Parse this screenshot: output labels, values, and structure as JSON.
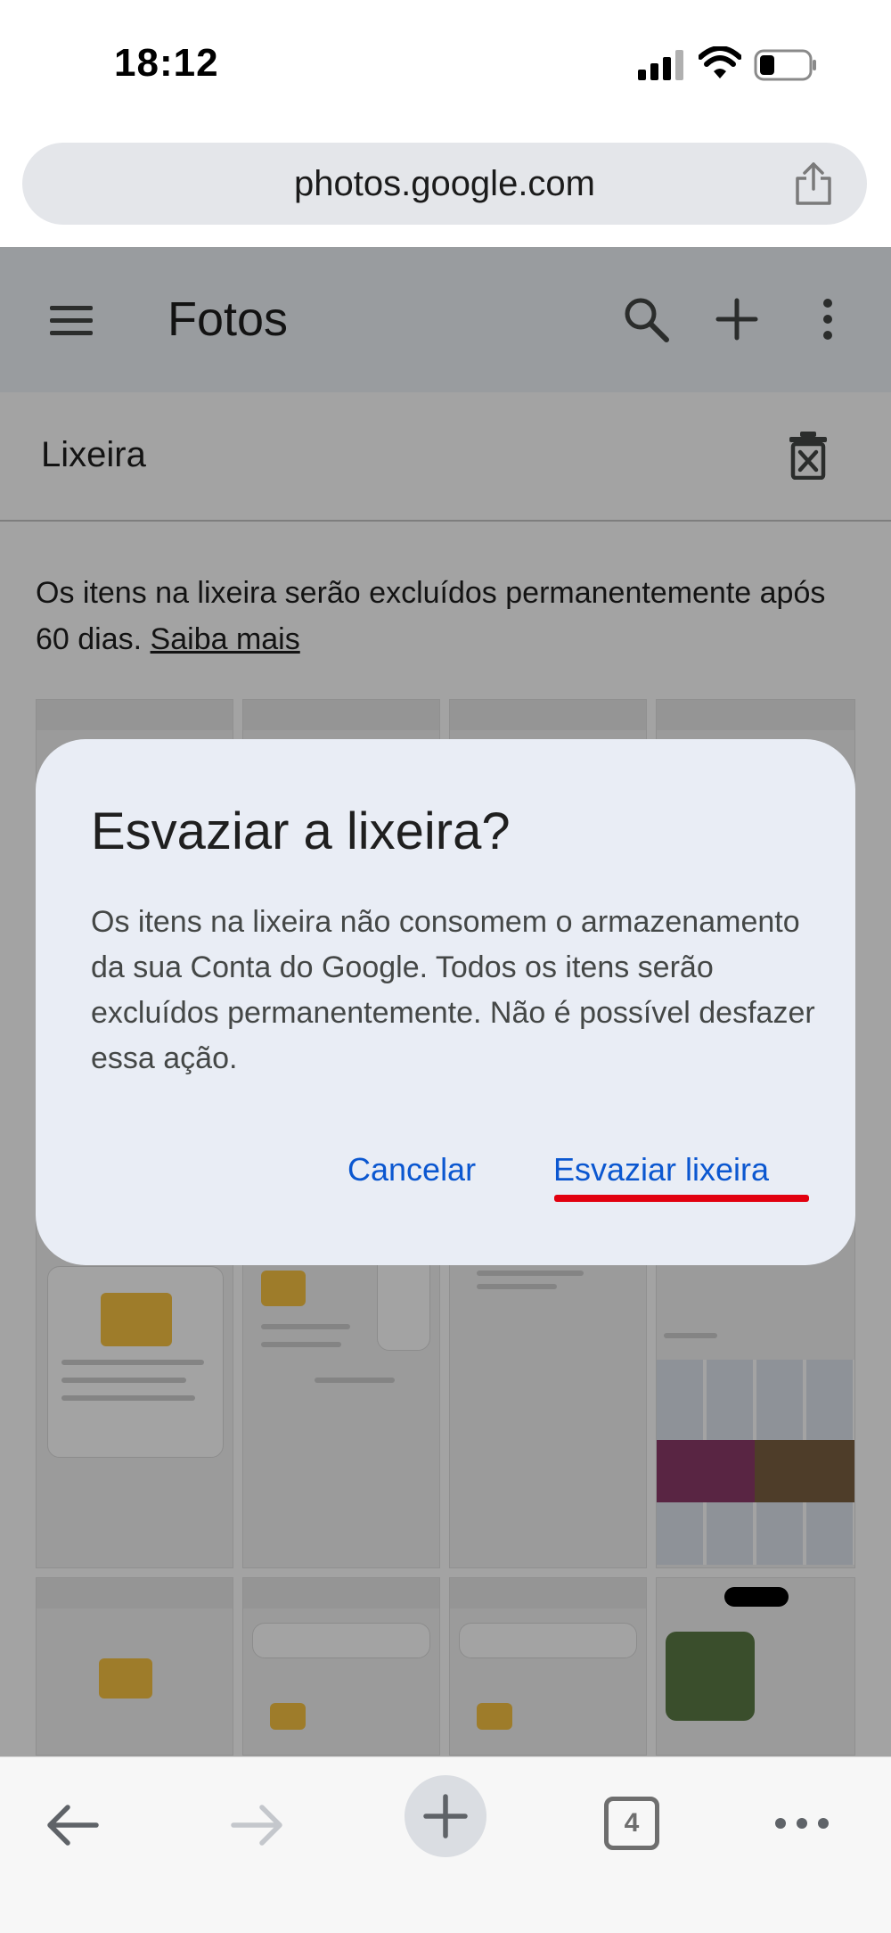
{
  "status_bar": {
    "time": "18:12"
  },
  "browser": {
    "url": "photos.google.com",
    "tab_count": "4"
  },
  "app": {
    "title": "Fotos",
    "section_title": "Lixeira",
    "info_text": "Os itens na lixeira serão excluídos permanentemente após 60 dias.",
    "info_link": "Saiba mais"
  },
  "dialog": {
    "title": "Esvaziar a lixeira?",
    "body": "Os itens na lixeira não consomem o armazenamento da sua Conta do Google. Todos os itens serão excluídos permanentemente. Não é possível desfazer essa ação.",
    "cancel_label": "Cancelar",
    "confirm_label": "Esvaziar lixeira"
  },
  "colors": {
    "accent_blue": "#0b57d0",
    "highlight_red": "#e2000f",
    "header_bg": "#f0f4f9",
    "dialog_bg": "#e9edf5"
  },
  "icons": [
    "signal-icon",
    "wifi-icon",
    "battery-icon",
    "share-icon",
    "menu-icon",
    "search-icon",
    "add-icon",
    "more-vert-icon",
    "empty-trash-icon",
    "back-icon",
    "forward-icon",
    "new-tab-icon",
    "tabs-icon",
    "more-horiz-icon"
  ]
}
